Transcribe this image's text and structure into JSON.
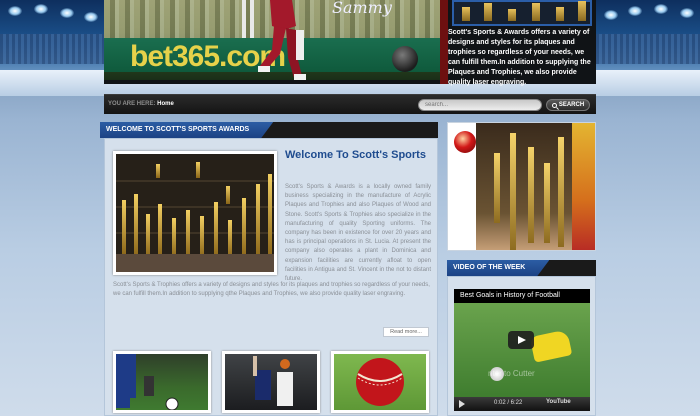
{
  "header": {
    "signature": "Sammy",
    "banner_ad": "bet365.com",
    "description": "Scott's Sports & Awards offers a variety of designs and styles for its plaques and trophies so regardless of your needs, we can fulfill them.In addition to supplying the Plaques and Trophies, we also provide quality laser engraving."
  },
  "nav": {
    "you_are_here_label": "YOU ARE HERE:",
    "current_page": "Home",
    "search_placeholder": "search...",
    "search_button": "SEARCH"
  },
  "main": {
    "section_title": "WELCOME TO SCOTT'S SPORTS AWARDS",
    "heading": "Welcome To Scott's Sports",
    "paragraph1": "Scott's Sports & Awards is a locally owned family business specializing in the manufacture of Acrylic Plaques and Trophies and also Plaques of Wood and Stone. Scott's Sports & Trophies also specialize in the manufacturing of quality Sporting uniforms. The company has been in existence for over 20 years and has is principal operations in St. Lucia. At present the company also operates a plant in Dominica and expansion facilities are currently afloat to open facilities in Antigua and St. Vincent in the not to distant future.",
    "paragraph2": "Scott's Sports & Trophies offers a variety of designs and styles for its plaques and trophies so regardless of your needs, we can fulfill them.In addition to supplying qthe Plaques and Trophies, we also provide quality laser engraving.",
    "read_more": "Read more..."
  },
  "sidebar": {
    "video_section_title": "VIDEO OF THE WEEK",
    "video_title": "Best Goals in History of Football",
    "video_time": "0:02 / 6:22",
    "video_watermark": "nter to Cutter",
    "video_brand": "YouTube"
  },
  "colors": {
    "accent_blue": "#1f4c8f",
    "header_bg": "#101316",
    "content_bg": "#d5e0ec"
  }
}
